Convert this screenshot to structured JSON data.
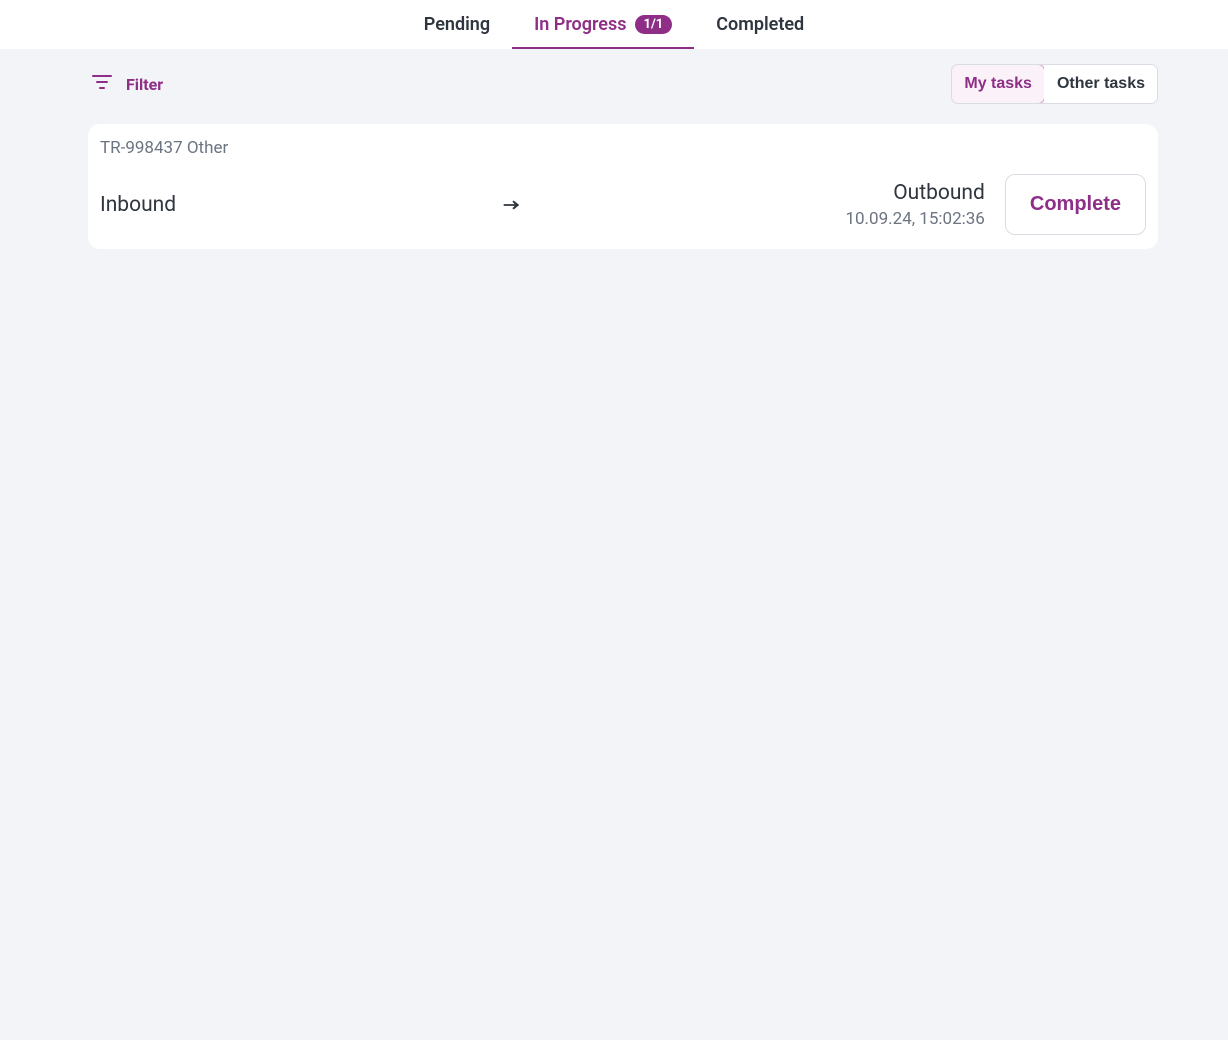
{
  "tabs": {
    "pending": {
      "label": "Pending"
    },
    "in_progress": {
      "label": "In Progress",
      "badge": "1/1"
    },
    "completed": {
      "label": "Completed"
    }
  },
  "toolbar": {
    "filter_label": "Filter",
    "my_tasks_label": "My tasks",
    "other_tasks_label": "Other tasks"
  },
  "task": {
    "id_line": "TR-998437 Other",
    "inbound_label": "Inbound",
    "outbound_label": "Outbound",
    "timestamp": "10.09.24, 15:02:36",
    "complete_label": "Complete"
  },
  "colors": {
    "accent": "#8e2e87",
    "text_primary": "#2f3640",
    "text_secondary": "#6c7482",
    "page_bg": "#f3f4f7"
  }
}
